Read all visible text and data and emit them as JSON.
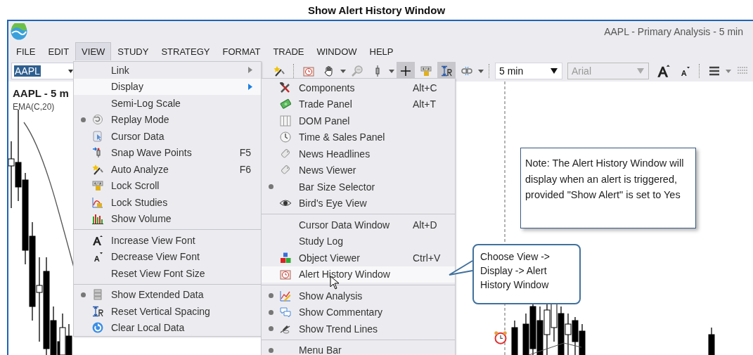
{
  "page_title": "Show Alert History Window",
  "window": {
    "title": "AAPL - Primary Analysis - 5 min"
  },
  "menu_bar": [
    {
      "label": "FILE",
      "selected": false
    },
    {
      "label": "EDIT",
      "selected": false
    },
    {
      "label": "VIEW",
      "selected": true
    },
    {
      "label": "STUDY",
      "selected": false
    },
    {
      "label": "STRATEGY",
      "selected": false
    },
    {
      "label": "FORMAT",
      "selected": false
    },
    {
      "label": "TRADE",
      "selected": false
    },
    {
      "label": "WINDOW",
      "selected": false
    },
    {
      "label": "HELP",
      "selected": false
    }
  ],
  "toolbar": {
    "symbol": "AAPL",
    "buttons": [
      {
        "pressed": false
      },
      {
        "pressed": false
      },
      {
        "pressed": false
      },
      {
        "pressed": false
      },
      {
        "pressed": false
      },
      {
        "pressed": true
      },
      {
        "pressed": false
      },
      {
        "pressed": true
      },
      {
        "pressed": false
      }
    ],
    "interval": "5 min",
    "font": {
      "value": "Arial",
      "disabled": true
    }
  },
  "chart": {
    "symbol_label": "AAPL - 5 m",
    "study_label": "EMA(C,20)"
  },
  "view_menu": {
    "sections": [
      [
        {
          "label": "Link",
          "checked": false,
          "submenu": true,
          "selected": false
        },
        {
          "label": "Display",
          "checked": false,
          "submenu": true,
          "selected": true
        },
        {
          "label": "Semi-Log Scale",
          "checked": false,
          "submenu": false,
          "selected": false
        },
        {
          "label": "Replay Mode",
          "checked": true,
          "submenu": false,
          "selected": false
        },
        {
          "label": "Cursor Data",
          "checked": false,
          "submenu": false,
          "selected": false
        },
        {
          "label": "Snap Wave Points",
          "shortcut": "F5",
          "checked": false,
          "submenu": false,
          "selected": false
        },
        {
          "label": "Auto Analyze",
          "shortcut": "F6",
          "checked": false,
          "submenu": false,
          "selected": false
        },
        {
          "label": "Lock Scroll",
          "checked": false,
          "submenu": false,
          "selected": false
        },
        {
          "label": "Lock Studies",
          "checked": false,
          "submenu": false,
          "selected": false
        },
        {
          "label": "Show Volume",
          "checked": false,
          "submenu": false,
          "selected": false
        }
      ],
      [
        {
          "label": "Increase View Font",
          "checked": false,
          "submenu": false,
          "selected": false
        },
        {
          "label": "Decrease View Font",
          "checked": false,
          "submenu": false,
          "selected": false
        },
        {
          "label": "Reset View Font Size",
          "checked": false,
          "submenu": false,
          "selected": false
        }
      ],
      [
        {
          "label": "Show Extended Data",
          "checked": true,
          "submenu": false,
          "selected": false
        },
        {
          "label": "Reset Vertical Spacing",
          "checked": false,
          "submenu": false,
          "selected": false
        },
        {
          "label": "Clear Local Data",
          "checked": false,
          "submenu": false,
          "selected": false
        }
      ]
    ]
  },
  "display_submenu": {
    "sections": [
      [
        {
          "label": "Components",
          "shortcut": "Alt+C",
          "checked": false,
          "selected": false
        },
        {
          "label": "Trade Panel",
          "shortcut": "Alt+T",
          "checked": false,
          "selected": false
        },
        {
          "label": "DOM Panel",
          "checked": false,
          "selected": false
        },
        {
          "label": "Time & Sales Panel",
          "checked": false,
          "selected": false
        },
        {
          "label": "News Headlines",
          "checked": false,
          "selected": false
        },
        {
          "label": "News Viewer",
          "checked": false,
          "selected": false
        },
        {
          "label": "Bar Size Selector",
          "checked": true,
          "selected": false
        },
        {
          "label": "Bird's Eye View",
          "checked": false,
          "selected": false
        }
      ],
      [
        {
          "label": "Cursor Data Window",
          "shortcut": "Alt+D",
          "checked": false,
          "selected": false
        },
        {
          "label": "Study Log",
          "checked": false,
          "selected": false
        },
        {
          "label": "Object Viewer",
          "shortcut": "Ctrl+V",
          "checked": false,
          "selected": false
        },
        {
          "label": "Alert History Window",
          "checked": false,
          "selected": true
        }
      ],
      [
        {
          "label": "Show Analysis",
          "checked": true,
          "selected": false
        },
        {
          "label": "Show Commentary",
          "checked": true,
          "selected": false
        },
        {
          "label": "Show Trend Lines",
          "checked": true,
          "selected": false
        }
      ],
      [
        {
          "label": "Menu Bar",
          "checked": true,
          "selected": false
        }
      ]
    ]
  },
  "callouts": [
    {
      "kind": "note",
      "text": "Note: The Alert History Window will display when an alert is triggered, provided \"Show Alert\" is set to Yes"
    },
    {
      "kind": "pointer",
      "text": "Choose View -> Display -> Alert History Window"
    }
  ]
}
